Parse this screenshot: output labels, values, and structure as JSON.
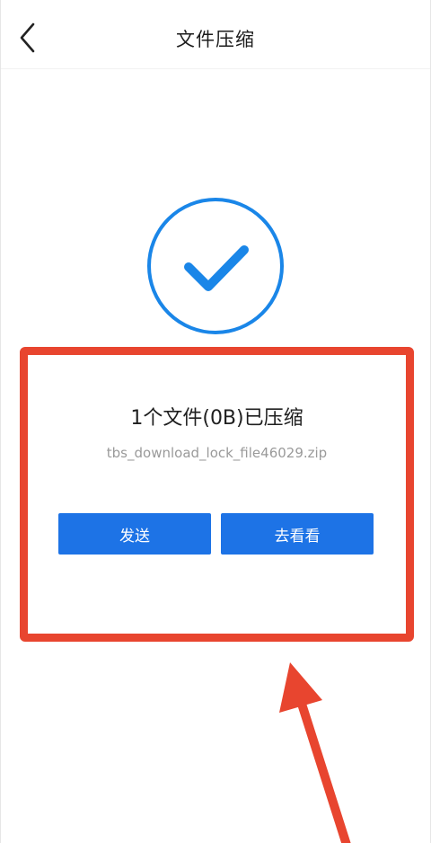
{
  "header": {
    "title": "文件压缩",
    "back_icon": "chevron-left-icon"
  },
  "status": {
    "icon": "check-circle-icon",
    "accent_color": "#1a86e8"
  },
  "result": {
    "title": "1个文件(0B)已压缩",
    "file_name": "tbs_download_lock_file46029.zip"
  },
  "actions": {
    "send_label": "发送",
    "view_label": "去看看",
    "button_color": "#1d73e6"
  },
  "annotation": {
    "highlight_color": "#e8452f"
  }
}
